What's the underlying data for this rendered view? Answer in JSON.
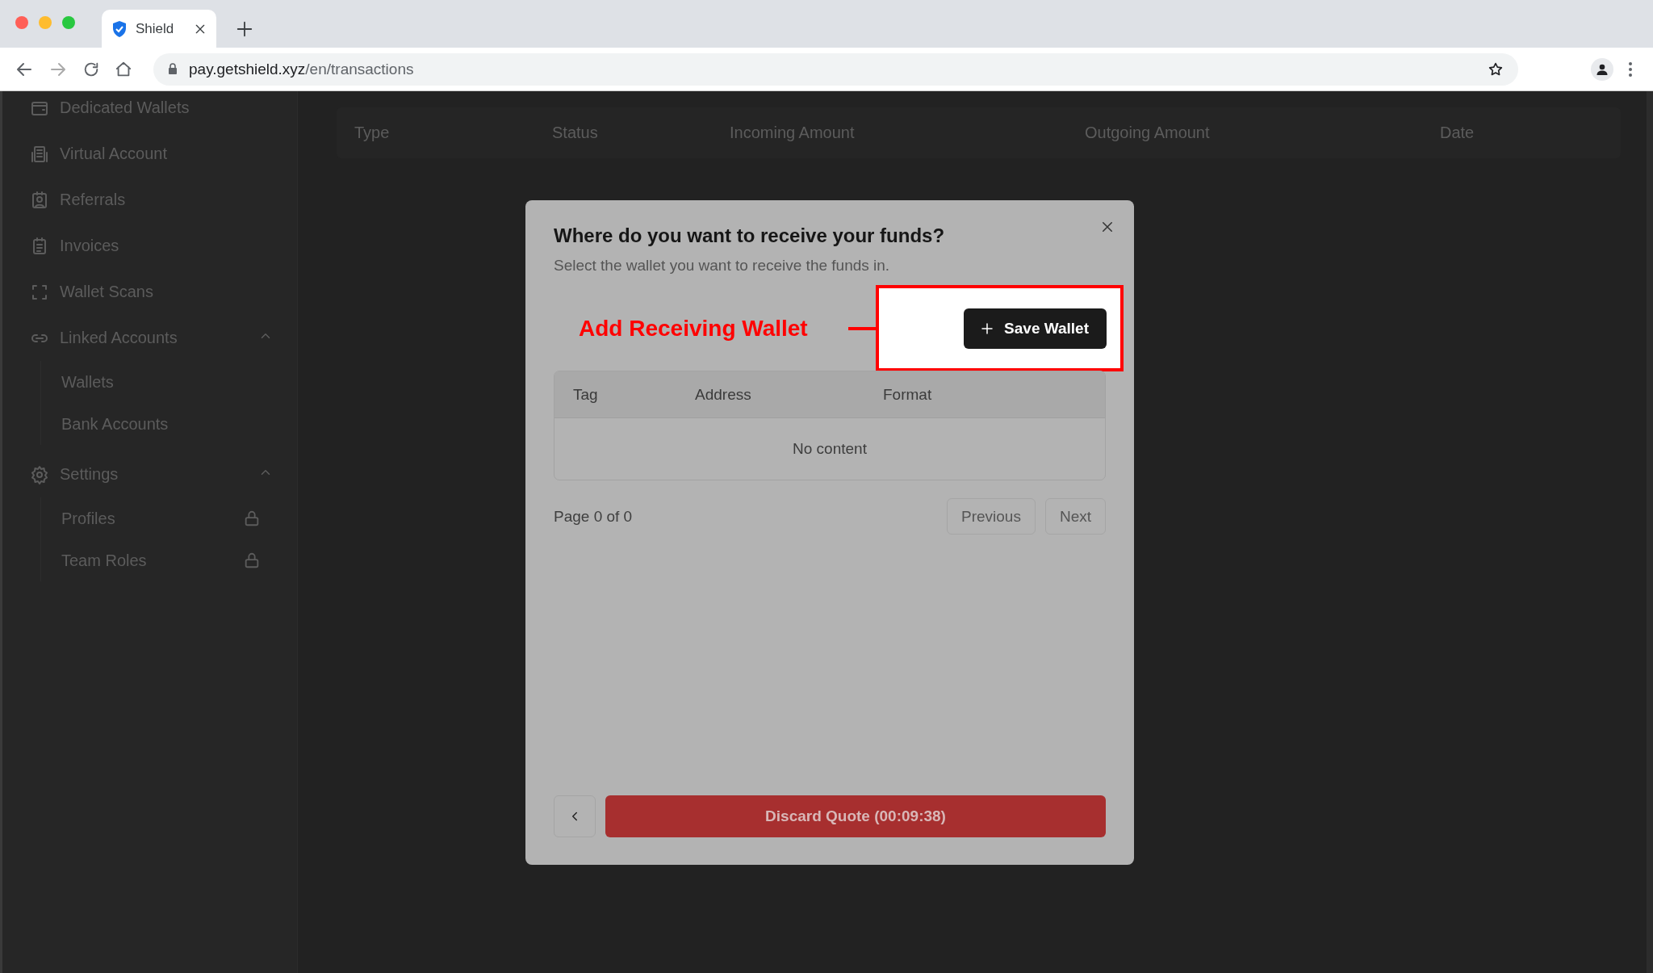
{
  "browser": {
    "tab_title": "Shield",
    "url_host": "pay.getshield.xyz",
    "url_path": "/en/transactions"
  },
  "sidebar": {
    "items": [
      {
        "kind": "link",
        "label": "Dedicated Wallets"
      },
      {
        "kind": "link",
        "label": "Virtual Account"
      },
      {
        "kind": "link",
        "label": "Referrals"
      },
      {
        "kind": "link",
        "label": "Invoices"
      },
      {
        "kind": "link",
        "label": "Wallet Scans"
      },
      {
        "kind": "group",
        "label": "Linked Accounts",
        "expanded": true,
        "children": [
          {
            "label": "Wallets",
            "locked": false
          },
          {
            "label": "Bank Accounts",
            "locked": false
          }
        ]
      },
      {
        "kind": "group",
        "label": "Settings",
        "expanded": true,
        "children": [
          {
            "label": "Profiles",
            "locked": true
          },
          {
            "label": "Team Roles",
            "locked": true
          }
        ]
      }
    ]
  },
  "table": {
    "columns": [
      "Type",
      "Status",
      "Incoming Amount",
      "Outgoing Amount",
      "Date"
    ]
  },
  "modal": {
    "title": "Where do you want to receive your funds?",
    "subtitle": "Select the wallet you want to receive the funds in.",
    "annotation": "Add Receiving Wallet",
    "save_button": "Save Wallet",
    "wallet_table": {
      "columns": [
        "Tag",
        "Address",
        "Format"
      ],
      "empty_text": "No content"
    },
    "page_info": "Page 0 of 0",
    "pagination": [
      "Previous",
      "Next"
    ],
    "discard_button": "Discard Quote (00:09:38)"
  }
}
